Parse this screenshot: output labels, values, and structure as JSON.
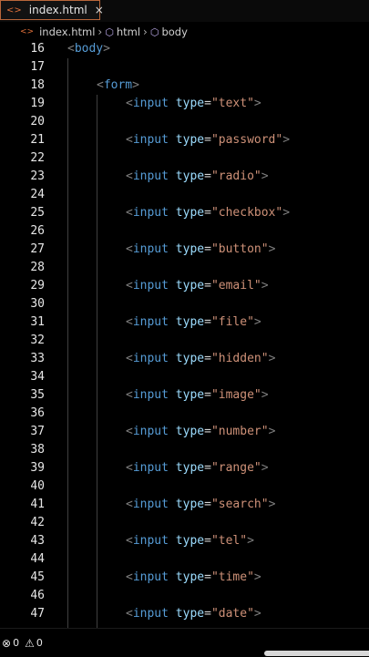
{
  "tab": {
    "icon": "html-file-icon",
    "label": "index.html",
    "close": "×"
  },
  "breadcrumb": {
    "file": "index.html",
    "items": [
      "html",
      "body"
    ]
  },
  "editor": {
    "lines": [
      {
        "n": "16",
        "indent": 0,
        "tokens": [
          [
            "punc",
            "<"
          ],
          [
            "tag",
            "body"
          ],
          [
            "punc",
            ">"
          ]
        ]
      },
      {
        "n": "17",
        "indent": 0,
        "tokens": []
      },
      {
        "n": "18",
        "indent": 1,
        "tokens": [
          [
            "punc",
            "<"
          ],
          [
            "tag",
            "form"
          ],
          [
            "punc",
            ">"
          ]
        ]
      },
      {
        "n": "19",
        "indent": 2,
        "tokens": [
          [
            "punc",
            "<"
          ],
          [
            "tag",
            "input"
          ],
          [
            "sp",
            " "
          ],
          [
            "attr",
            "type"
          ],
          [
            "eq",
            "="
          ],
          [
            "str",
            "\"text\""
          ],
          [
            "punc",
            ">"
          ]
        ]
      },
      {
        "n": "20",
        "indent": 0,
        "tokens": []
      },
      {
        "n": "21",
        "indent": 2,
        "tokens": [
          [
            "punc",
            "<"
          ],
          [
            "tag",
            "input"
          ],
          [
            "sp",
            " "
          ],
          [
            "attr",
            "type"
          ],
          [
            "eq",
            "="
          ],
          [
            "str",
            "\"password\""
          ],
          [
            "punc",
            ">"
          ]
        ]
      },
      {
        "n": "22",
        "indent": 0,
        "tokens": []
      },
      {
        "n": "23",
        "indent": 2,
        "tokens": [
          [
            "punc",
            "<"
          ],
          [
            "tag",
            "input"
          ],
          [
            "sp",
            " "
          ],
          [
            "attr",
            "type"
          ],
          [
            "eq",
            "="
          ],
          [
            "str",
            "\"radio\""
          ],
          [
            "punc",
            ">"
          ]
        ]
      },
      {
        "n": "24",
        "indent": 0,
        "tokens": []
      },
      {
        "n": "25",
        "indent": 2,
        "tokens": [
          [
            "punc",
            "<"
          ],
          [
            "tag",
            "input"
          ],
          [
            "sp",
            " "
          ],
          [
            "attr",
            "type"
          ],
          [
            "eq",
            "="
          ],
          [
            "str",
            "\"checkbox\""
          ],
          [
            "punc",
            ">"
          ]
        ]
      },
      {
        "n": "26",
        "indent": 0,
        "tokens": []
      },
      {
        "n": "27",
        "indent": 2,
        "tokens": [
          [
            "punc",
            "<"
          ],
          [
            "tag",
            "input"
          ],
          [
            "sp",
            " "
          ],
          [
            "attr",
            "type"
          ],
          [
            "eq",
            "="
          ],
          [
            "str",
            "\"button\""
          ],
          [
            "punc",
            ">"
          ]
        ]
      },
      {
        "n": "28",
        "indent": 0,
        "tokens": []
      },
      {
        "n": "29",
        "indent": 2,
        "tokens": [
          [
            "punc",
            "<"
          ],
          [
            "tag",
            "input"
          ],
          [
            "sp",
            " "
          ],
          [
            "attr",
            "type"
          ],
          [
            "eq",
            "="
          ],
          [
            "str",
            "\"email\""
          ],
          [
            "punc",
            ">"
          ]
        ]
      },
      {
        "n": "30",
        "indent": 0,
        "tokens": []
      },
      {
        "n": "31",
        "indent": 2,
        "tokens": [
          [
            "punc",
            "<"
          ],
          [
            "tag",
            "input"
          ],
          [
            "sp",
            " "
          ],
          [
            "attr",
            "type"
          ],
          [
            "eq",
            "="
          ],
          [
            "str",
            "\"file\""
          ],
          [
            "punc",
            ">"
          ]
        ]
      },
      {
        "n": "32",
        "indent": 0,
        "tokens": []
      },
      {
        "n": "33",
        "indent": 2,
        "tokens": [
          [
            "punc",
            "<"
          ],
          [
            "tag",
            "input"
          ],
          [
            "sp",
            " "
          ],
          [
            "attr",
            "type"
          ],
          [
            "eq",
            "="
          ],
          [
            "str",
            "\"hidden\""
          ],
          [
            "punc",
            ">"
          ]
        ]
      },
      {
        "n": "34",
        "indent": 0,
        "tokens": []
      },
      {
        "n": "35",
        "indent": 2,
        "tokens": [
          [
            "punc",
            "<"
          ],
          [
            "tag",
            "input"
          ],
          [
            "sp",
            " "
          ],
          [
            "attr",
            "type"
          ],
          [
            "eq",
            "="
          ],
          [
            "str",
            "\"image\""
          ],
          [
            "punc",
            ">"
          ]
        ]
      },
      {
        "n": "36",
        "indent": 0,
        "tokens": []
      },
      {
        "n": "37",
        "indent": 2,
        "tokens": [
          [
            "punc",
            "<"
          ],
          [
            "tag",
            "input"
          ],
          [
            "sp",
            " "
          ],
          [
            "attr",
            "type"
          ],
          [
            "eq",
            "="
          ],
          [
            "str",
            "\"number\""
          ],
          [
            "punc",
            ">"
          ]
        ]
      },
      {
        "n": "38",
        "indent": 0,
        "tokens": []
      },
      {
        "n": "39",
        "indent": 2,
        "tokens": [
          [
            "punc",
            "<"
          ],
          [
            "tag",
            "input"
          ],
          [
            "sp",
            " "
          ],
          [
            "attr",
            "type"
          ],
          [
            "eq",
            "="
          ],
          [
            "str",
            "\"range\""
          ],
          [
            "punc",
            ">"
          ]
        ]
      },
      {
        "n": "40",
        "indent": 0,
        "tokens": []
      },
      {
        "n": "41",
        "indent": 2,
        "tokens": [
          [
            "punc",
            "<"
          ],
          [
            "tag",
            "input"
          ],
          [
            "sp",
            " "
          ],
          [
            "attr",
            "type"
          ],
          [
            "eq",
            "="
          ],
          [
            "str",
            "\"search\""
          ],
          [
            "punc",
            ">"
          ]
        ]
      },
      {
        "n": "42",
        "indent": 0,
        "tokens": []
      },
      {
        "n": "43",
        "indent": 2,
        "tokens": [
          [
            "punc",
            "<"
          ],
          [
            "tag",
            "input"
          ],
          [
            "sp",
            " "
          ],
          [
            "attr",
            "type"
          ],
          [
            "eq",
            "="
          ],
          [
            "str",
            "\"tel\""
          ],
          [
            "punc",
            ">"
          ]
        ]
      },
      {
        "n": "44",
        "indent": 0,
        "tokens": []
      },
      {
        "n": "45",
        "indent": 2,
        "tokens": [
          [
            "punc",
            "<"
          ],
          [
            "tag",
            "input"
          ],
          [
            "sp",
            " "
          ],
          [
            "attr",
            "type"
          ],
          [
            "eq",
            "="
          ],
          [
            "str",
            "\"time\""
          ],
          [
            "punc",
            ">"
          ]
        ]
      },
      {
        "n": "46",
        "indent": 0,
        "tokens": []
      },
      {
        "n": "47",
        "indent": 2,
        "tokens": [
          [
            "punc",
            "<"
          ],
          [
            "tag",
            "input"
          ],
          [
            "sp",
            " "
          ],
          [
            "attr",
            "type"
          ],
          [
            "eq",
            "="
          ],
          [
            "str",
            "\"date\""
          ],
          [
            "punc",
            ">"
          ]
        ]
      }
    ]
  },
  "status": {
    "errors": "0",
    "warnings": "0"
  },
  "colors": {
    "tag": "#569cd6",
    "attr": "#9cdcfe",
    "string": "#ce9178",
    "punctuation": "#7f7f7f",
    "accent": "#e0703a"
  }
}
